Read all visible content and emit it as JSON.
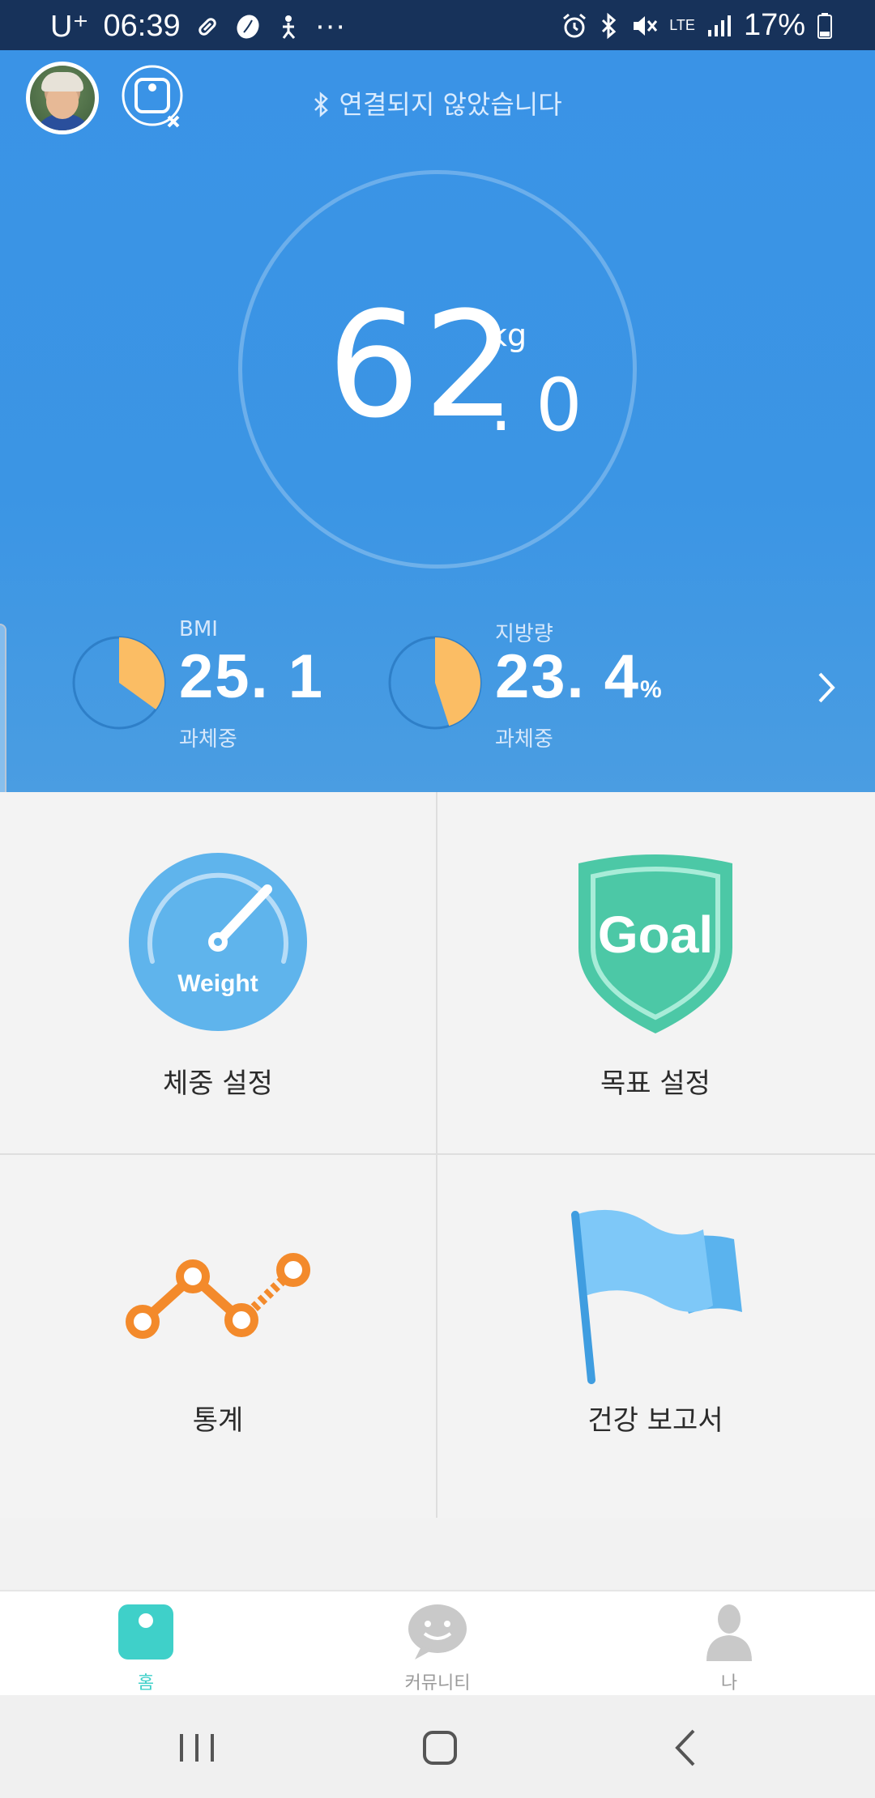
{
  "status_bar": {
    "carrier": "U⁺",
    "time": "06:39",
    "more": "···",
    "network": "LTE",
    "battery": "17%"
  },
  "header": {
    "connection_status": "연결되지 않았습니다"
  },
  "weight": {
    "integer": "62",
    "unit": "kg",
    "decimal": ". 0"
  },
  "metrics": {
    "bmi": {
      "name": "BMI",
      "value": "25. 1",
      "unit": "",
      "status": "과체중",
      "fill_fraction": 0.35
    },
    "fat": {
      "name": "지방량",
      "value": "23. 4",
      "unit": "%",
      "status": "과체중",
      "fill_fraction": 0.45
    }
  },
  "menu": {
    "weight_setting": {
      "label": "체중 설정",
      "icon_text": "Weight"
    },
    "goal_setting": {
      "label": "목표 설정",
      "icon_text": "Goal"
    },
    "statistics": {
      "label": "통계"
    },
    "health_report": {
      "label": "건강 보고서"
    }
  },
  "bottom_nav": {
    "home": "홈",
    "community": "커뮤니티",
    "me": "나"
  },
  "colors": {
    "hero_blue": "#3a93e6",
    "accent_orange": "#fbbd64",
    "teal": "#3fd0c9",
    "goal_green": "#4cc8a6",
    "stat_orange": "#f38a2b",
    "flag_blue": "#7ec8f8"
  }
}
